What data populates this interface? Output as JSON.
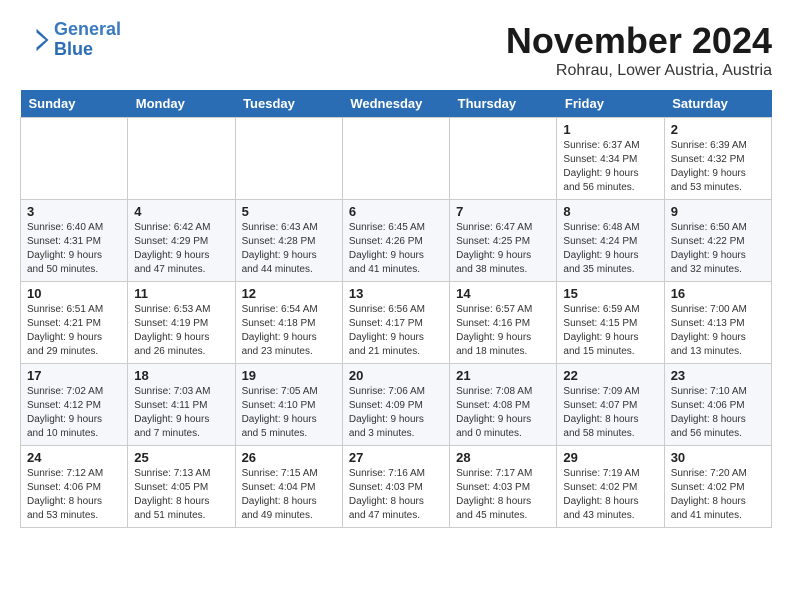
{
  "header": {
    "logo_line1": "General",
    "logo_line2": "Blue",
    "month": "November 2024",
    "location": "Rohrau, Lower Austria, Austria"
  },
  "weekdays": [
    "Sunday",
    "Monday",
    "Tuesday",
    "Wednesday",
    "Thursday",
    "Friday",
    "Saturday"
  ],
  "weeks": [
    [
      {
        "day": "",
        "info": ""
      },
      {
        "day": "",
        "info": ""
      },
      {
        "day": "",
        "info": ""
      },
      {
        "day": "",
        "info": ""
      },
      {
        "day": "",
        "info": ""
      },
      {
        "day": "1",
        "info": "Sunrise: 6:37 AM\nSunset: 4:34 PM\nDaylight: 9 hours and 56 minutes."
      },
      {
        "day": "2",
        "info": "Sunrise: 6:39 AM\nSunset: 4:32 PM\nDaylight: 9 hours and 53 minutes."
      }
    ],
    [
      {
        "day": "3",
        "info": "Sunrise: 6:40 AM\nSunset: 4:31 PM\nDaylight: 9 hours and 50 minutes."
      },
      {
        "day": "4",
        "info": "Sunrise: 6:42 AM\nSunset: 4:29 PM\nDaylight: 9 hours and 47 minutes."
      },
      {
        "day": "5",
        "info": "Sunrise: 6:43 AM\nSunset: 4:28 PM\nDaylight: 9 hours and 44 minutes."
      },
      {
        "day": "6",
        "info": "Sunrise: 6:45 AM\nSunset: 4:26 PM\nDaylight: 9 hours and 41 minutes."
      },
      {
        "day": "7",
        "info": "Sunrise: 6:47 AM\nSunset: 4:25 PM\nDaylight: 9 hours and 38 minutes."
      },
      {
        "day": "8",
        "info": "Sunrise: 6:48 AM\nSunset: 4:24 PM\nDaylight: 9 hours and 35 minutes."
      },
      {
        "day": "9",
        "info": "Sunrise: 6:50 AM\nSunset: 4:22 PM\nDaylight: 9 hours and 32 minutes."
      }
    ],
    [
      {
        "day": "10",
        "info": "Sunrise: 6:51 AM\nSunset: 4:21 PM\nDaylight: 9 hours and 29 minutes."
      },
      {
        "day": "11",
        "info": "Sunrise: 6:53 AM\nSunset: 4:19 PM\nDaylight: 9 hours and 26 minutes."
      },
      {
        "day": "12",
        "info": "Sunrise: 6:54 AM\nSunset: 4:18 PM\nDaylight: 9 hours and 23 minutes."
      },
      {
        "day": "13",
        "info": "Sunrise: 6:56 AM\nSunset: 4:17 PM\nDaylight: 9 hours and 21 minutes."
      },
      {
        "day": "14",
        "info": "Sunrise: 6:57 AM\nSunset: 4:16 PM\nDaylight: 9 hours and 18 minutes."
      },
      {
        "day": "15",
        "info": "Sunrise: 6:59 AM\nSunset: 4:15 PM\nDaylight: 9 hours and 15 minutes."
      },
      {
        "day": "16",
        "info": "Sunrise: 7:00 AM\nSunset: 4:13 PM\nDaylight: 9 hours and 13 minutes."
      }
    ],
    [
      {
        "day": "17",
        "info": "Sunrise: 7:02 AM\nSunset: 4:12 PM\nDaylight: 9 hours and 10 minutes."
      },
      {
        "day": "18",
        "info": "Sunrise: 7:03 AM\nSunset: 4:11 PM\nDaylight: 9 hours and 7 minutes."
      },
      {
        "day": "19",
        "info": "Sunrise: 7:05 AM\nSunset: 4:10 PM\nDaylight: 9 hours and 5 minutes."
      },
      {
        "day": "20",
        "info": "Sunrise: 7:06 AM\nSunset: 4:09 PM\nDaylight: 9 hours and 3 minutes."
      },
      {
        "day": "21",
        "info": "Sunrise: 7:08 AM\nSunset: 4:08 PM\nDaylight: 9 hours and 0 minutes."
      },
      {
        "day": "22",
        "info": "Sunrise: 7:09 AM\nSunset: 4:07 PM\nDaylight: 8 hours and 58 minutes."
      },
      {
        "day": "23",
        "info": "Sunrise: 7:10 AM\nSunset: 4:06 PM\nDaylight: 8 hours and 56 minutes."
      }
    ],
    [
      {
        "day": "24",
        "info": "Sunrise: 7:12 AM\nSunset: 4:06 PM\nDaylight: 8 hours and 53 minutes."
      },
      {
        "day": "25",
        "info": "Sunrise: 7:13 AM\nSunset: 4:05 PM\nDaylight: 8 hours and 51 minutes."
      },
      {
        "day": "26",
        "info": "Sunrise: 7:15 AM\nSunset: 4:04 PM\nDaylight: 8 hours and 49 minutes."
      },
      {
        "day": "27",
        "info": "Sunrise: 7:16 AM\nSunset: 4:03 PM\nDaylight: 8 hours and 47 minutes."
      },
      {
        "day": "28",
        "info": "Sunrise: 7:17 AM\nSunset: 4:03 PM\nDaylight: 8 hours and 45 minutes."
      },
      {
        "day": "29",
        "info": "Sunrise: 7:19 AM\nSunset: 4:02 PM\nDaylight: 8 hours and 43 minutes."
      },
      {
        "day": "30",
        "info": "Sunrise: 7:20 AM\nSunset: 4:02 PM\nDaylight: 8 hours and 41 minutes."
      }
    ]
  ]
}
